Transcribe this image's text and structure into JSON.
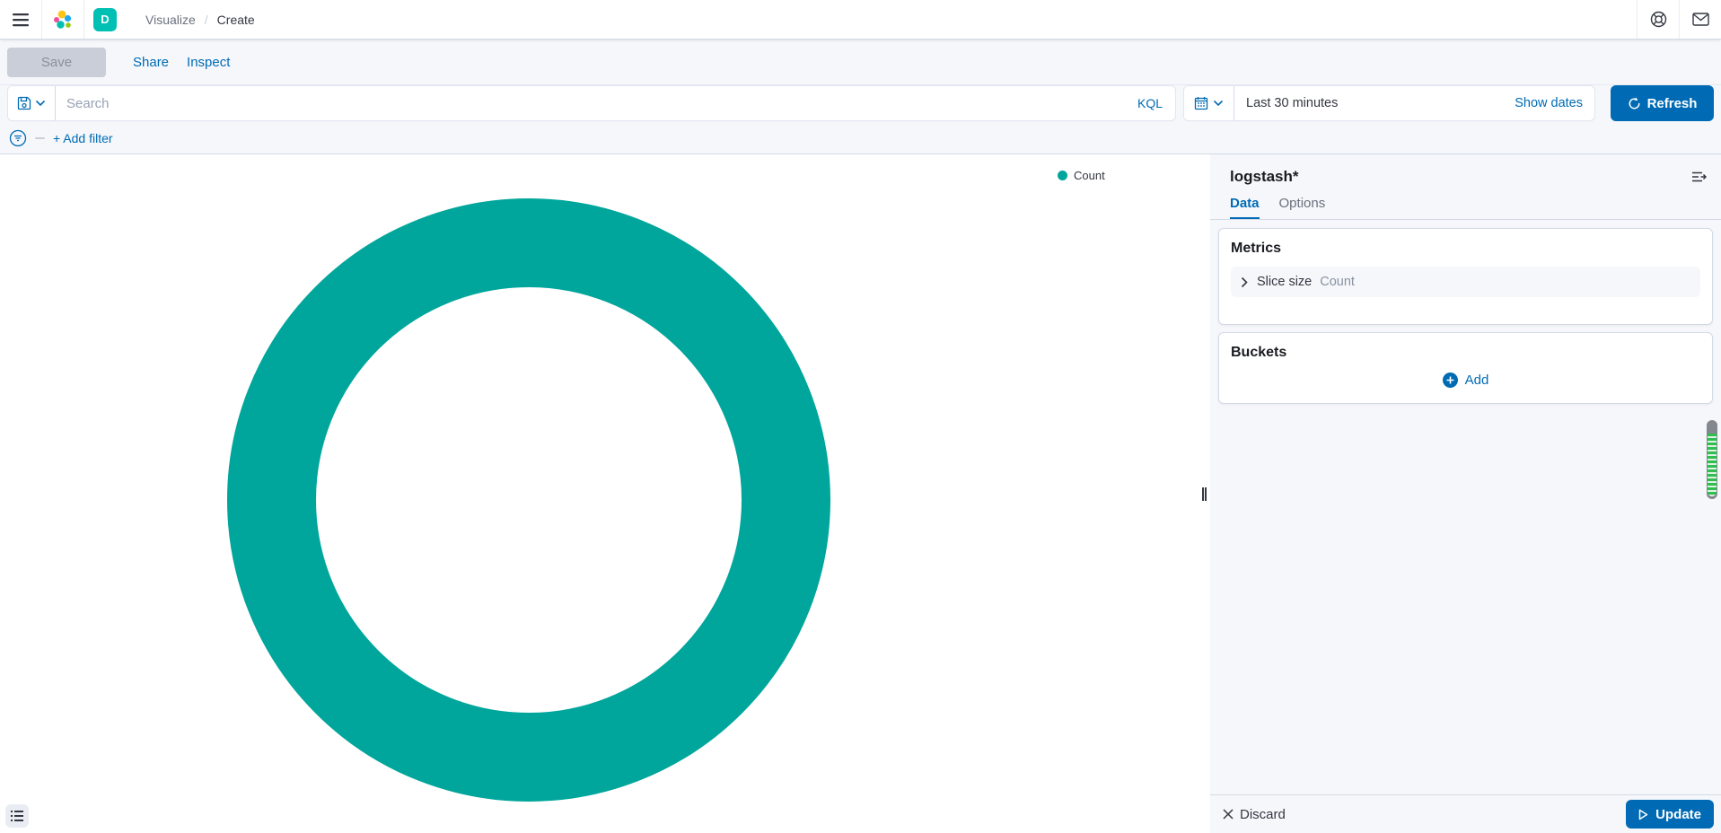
{
  "header": {
    "space_initial": "D",
    "breadcrumbs": [
      "Visualize",
      "Create"
    ]
  },
  "toolbar": {
    "save_label": "Save",
    "share_label": "Share",
    "inspect_label": "Inspect"
  },
  "query_bar": {
    "search_placeholder": "Search",
    "language_label": "KQL",
    "time_range": "Last 30 minutes",
    "show_dates_label": "Show dates",
    "refresh_label": "Refresh"
  },
  "filter_bar": {
    "add_filter_label": "+ Add filter"
  },
  "chart_data": {
    "type": "pie",
    "donut": true,
    "legend_position": "right",
    "slices": [
      {
        "label": "Count",
        "value": 100,
        "color": "#00A69B"
      }
    ]
  },
  "sidebar": {
    "index_pattern": "logstash*",
    "tabs": [
      {
        "label": "Data"
      },
      {
        "label": "Options"
      }
    ],
    "metrics": {
      "title": "Metrics",
      "slice_row": {
        "label": "Slice size",
        "value": "Count"
      }
    },
    "buckets": {
      "title": "Buckets",
      "add_label": "Add"
    },
    "footer": {
      "discard_label": "Discard",
      "update_label": "Update"
    }
  },
  "colors": {
    "accent": "#006BB4",
    "slice_teal": "#00A69B",
    "space_badge": "#00BFB3",
    "panel_bg": "#F5F7FA"
  }
}
